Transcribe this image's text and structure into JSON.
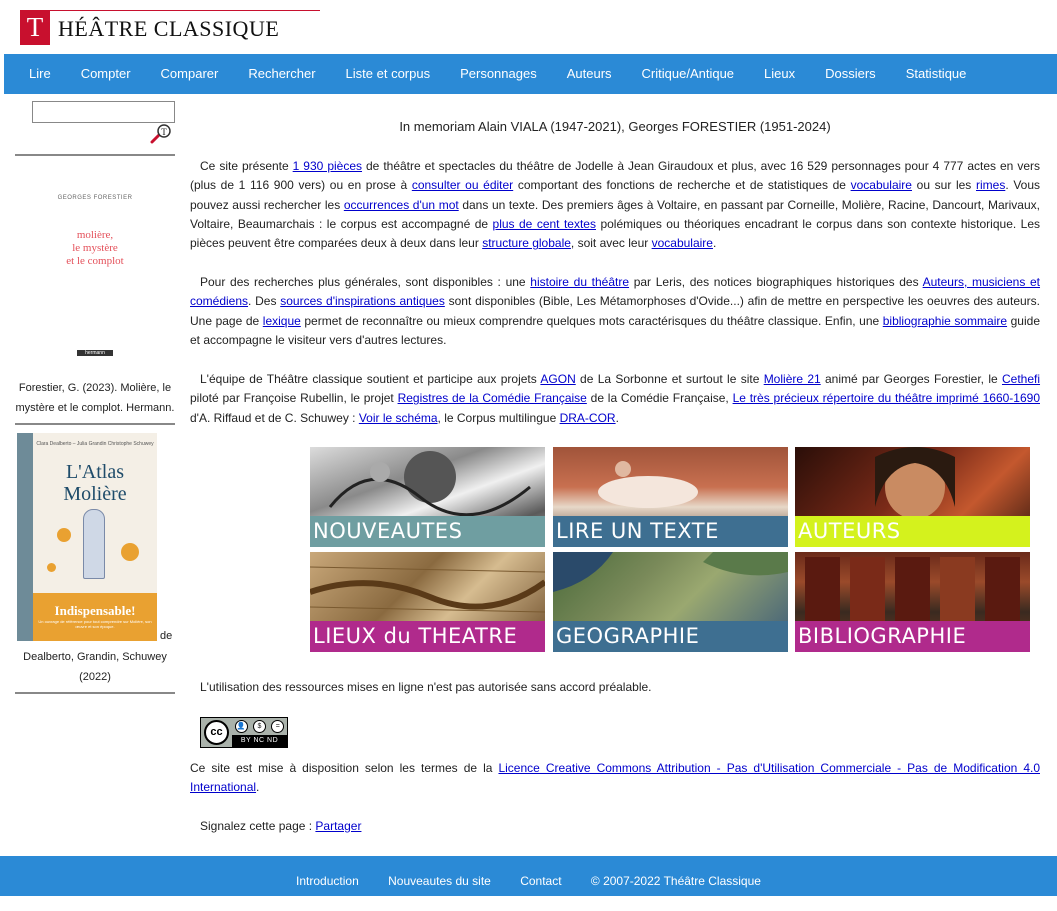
{
  "header": {
    "logo_letter": "T",
    "logo_text": "HÉÂTRE CLASSIQUE"
  },
  "nav": [
    "Lire",
    "Compter",
    "Comparer",
    "Rechercher",
    "Liste et corpus",
    "Personnages",
    "Auteurs",
    "Critique/Antique",
    "Lieux",
    "Dossiers",
    "Statistique"
  ],
  "search": {
    "placeholder": "",
    "value": ""
  },
  "sidebar": {
    "book1": {
      "author": "GEORGES FORESTIER",
      "title_line1": "molière,",
      "title_line2": "le mystère",
      "title_line3": "et le complot",
      "publisher": "hermann",
      "caption": "Forestier, G. (2023). Molière, le mystère et le complot. Hermann."
    },
    "book2": {
      "authors": "Clara Dealberto – Julia Grandin Christophe Schuwey",
      "title_line1": "L'Atlas",
      "title_line2": "Molière",
      "tagline": "Indispensable!",
      "subtitle": "Un ouvrage de référence pour tout comprendre sur Molière, son œuvre et son époque.",
      "de": "de",
      "caption": "Dealberto, Grandin, Schuwey (2022)"
    }
  },
  "main": {
    "memoriam": "In memoriam Alain VIALA (1947-2021), Georges FORESTIER (1951-2024)",
    "p1": {
      "t1": "Ce site présente ",
      "l1": "1 930 pièces",
      "t2": " de théâtre et spectacles du théâtre de Jodelle à Jean Giraudoux et plus, avec 16 529 personnages pour 4 777 actes en vers (plus de 1 116 900 vers) ou en prose à ",
      "l2": "consulter ou éditer",
      "t3": " comportant des fonctions de recherche et de statistiques de ",
      "l3": "vocabulaire",
      "t4": " ou sur les ",
      "l4": "rimes",
      "t5": ". Vous pouvez aussi rechercher les ",
      "l5": "occurrences d'un mot",
      "t6": " dans un texte. Des premiers âges à Voltaire, en passant par Corneille, Molière, Racine, Dancourt, Marivaux, Voltaire, Beaumarchais : le corpus est accompagné de ",
      "l6": "plus de cent textes",
      "t7": " polémiques ou théoriques encadrant le corpus dans son contexte historique. Les pièces peuvent être comparées deux à deux dans leur ",
      "l7": "structure globale",
      "t8": ", soit avec leur ",
      "l8": "vocabulaire",
      "t9": "."
    },
    "p2": {
      "t1": "Pour des recherches plus générales, sont disponibles : une ",
      "l1": "histoire du théâtre",
      "t2": " par Leris, des notices biographiques historiques des ",
      "l2": "Auteurs, musiciens et comédiens",
      "t3": ". Des ",
      "l3": "sources d'inspirations antiques",
      "t4": " sont disponibles (Bible, Les Métamorphoses d'Ovide...) afin de mettre en perspective les oeuvres des auteurs. Une page de ",
      "l4": "lexique",
      "t5": " permet de reconnaître ou mieux comprendre quelques mots caractérisques du théâtre classique. Enfin, une ",
      "l5": "bibliographie sommaire",
      "t6": " guide et accompagne le visiteur vers d'autres lectures."
    },
    "p3": {
      "t1": "L'équipe de Théâtre classique soutient et participe aux projets ",
      "l1": "AGON",
      "t2": " de La Sorbonne et surtout le site ",
      "l2": "Molière 21",
      "t3": " animé par Georges Forestier, le ",
      "l3": "Cethefi",
      "t4": " piloté par Françoise Rubellin, le projet ",
      "l4": "Registres de la Comédie Française",
      "t5": " de la Comédie Française, ",
      "l5": "Le très précieux répertoire du théâtre imprimé 1660-1690",
      "t6": " d'A. Riffaud et de C. Schuwey : ",
      "l6": "Voir le schéma",
      "t7": ", le Corpus multilingue ",
      "l7": "DRA-COR",
      "t8": "."
    },
    "tiles": [
      {
        "label": "NOUVEAUTES",
        "bar_color": "#6f9ea1"
      },
      {
        "label": "LIRE UN TEXTE",
        "bar_color": "#3e6f91"
      },
      {
        "label": "AUTEURS",
        "bar_color": "#d4f21d"
      },
      {
        "label": "LIEUX du THEATRE",
        "bar_color": "#b02a8c"
      },
      {
        "label": "GEOGRAPHIE",
        "bar_color": "#3e6f91"
      },
      {
        "label": "BIBLIOGRAPHIE",
        "bar_color": "#b02a8c"
      }
    ],
    "rights": "L'utilisation des ressources mises en ligne n'est pas autorisée sans accord préalable.",
    "licence": {
      "badge_cc": "cc",
      "badge_terms": "BY  NC  ND",
      "t1": "Ce site est mise à disposition selon les termes de la ",
      "l1": "Licence Creative Commons Attribution - Pas d'Utilisation Commerciale - Pas de Modification 4.0 International",
      "t2": "."
    },
    "share": {
      "t1": "Signalez cette page : ",
      "l1": "Partager"
    }
  },
  "footer": {
    "links": [
      "Introduction",
      "Nouveautes du site",
      "Contact"
    ],
    "copyright": "© 2007-2022 Théâtre Classique"
  }
}
